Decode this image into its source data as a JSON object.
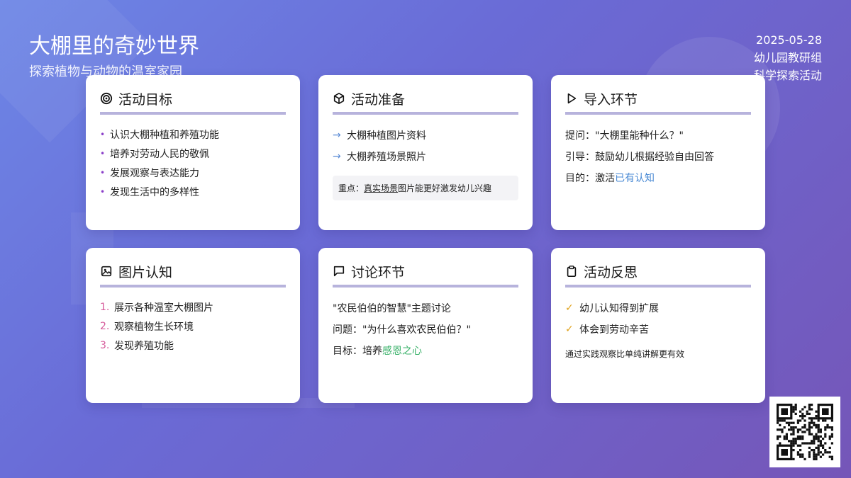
{
  "header": {
    "title": "大棚里的奇妙世界",
    "subtitle": "探索植物与动物的温室家园",
    "date": "2025-05-28",
    "org": "幼儿园教研组",
    "activity_type": "科学探索活动"
  },
  "cards": {
    "goals": {
      "icon": "target-icon",
      "title": "活动目标",
      "items": [
        "认识大棚种植和养殖功能",
        "培养对劳动人民的敬佩",
        "发展观察与表达能力",
        "发现生活中的多样性"
      ]
    },
    "prep": {
      "icon": "box-icon",
      "title": "活动准备",
      "items": [
        "大棚种植图片资料",
        "大棚养殖场景照片"
      ],
      "note_label": "重点：",
      "note_highlight": "真实场景",
      "note_rest": "图片能更好激发幼儿兴趣"
    },
    "intro": {
      "icon": "play-icon",
      "title": "导入环节",
      "q_label": "提问：",
      "q_text": "\"大棚里能种什么？\"",
      "guide_label": "引导：",
      "guide_text": "鼓励幼儿根据经验自由回答",
      "aim_label": "目的：",
      "aim_plain": "激活",
      "aim_highlight": "已有认知"
    },
    "pictures": {
      "icon": "image-icon",
      "title": "图片认知",
      "items": [
        "展示各种温室大棚图片",
        "观察植物生长环境",
        "发现养殖功能"
      ]
    },
    "discussion": {
      "icon": "chat-icon",
      "title": "讨论环节",
      "topic": "\"农民伯伯的智慧\"主题讨论",
      "q_label": "问题：",
      "q_text": "\"为什么喜欢农民伯伯？\"",
      "aim_label": "目标：",
      "aim_plain": "培养",
      "aim_highlight": "感恩之心"
    },
    "reflection": {
      "icon": "clipboard-icon",
      "title": "活动反思",
      "items": [
        "幼儿认知得到扩展",
        "体会到劳动辛苦"
      ],
      "note": "通过实践观察比单纯讲解更有效"
    }
  },
  "qr": {
    "icon": "qr-code-icon"
  },
  "colors": {
    "accent_purple": "#8b3fc9",
    "accent_blue": "#4a8ad4",
    "accent_green": "#3ab26a",
    "check_yellow": "#e0a21b"
  }
}
